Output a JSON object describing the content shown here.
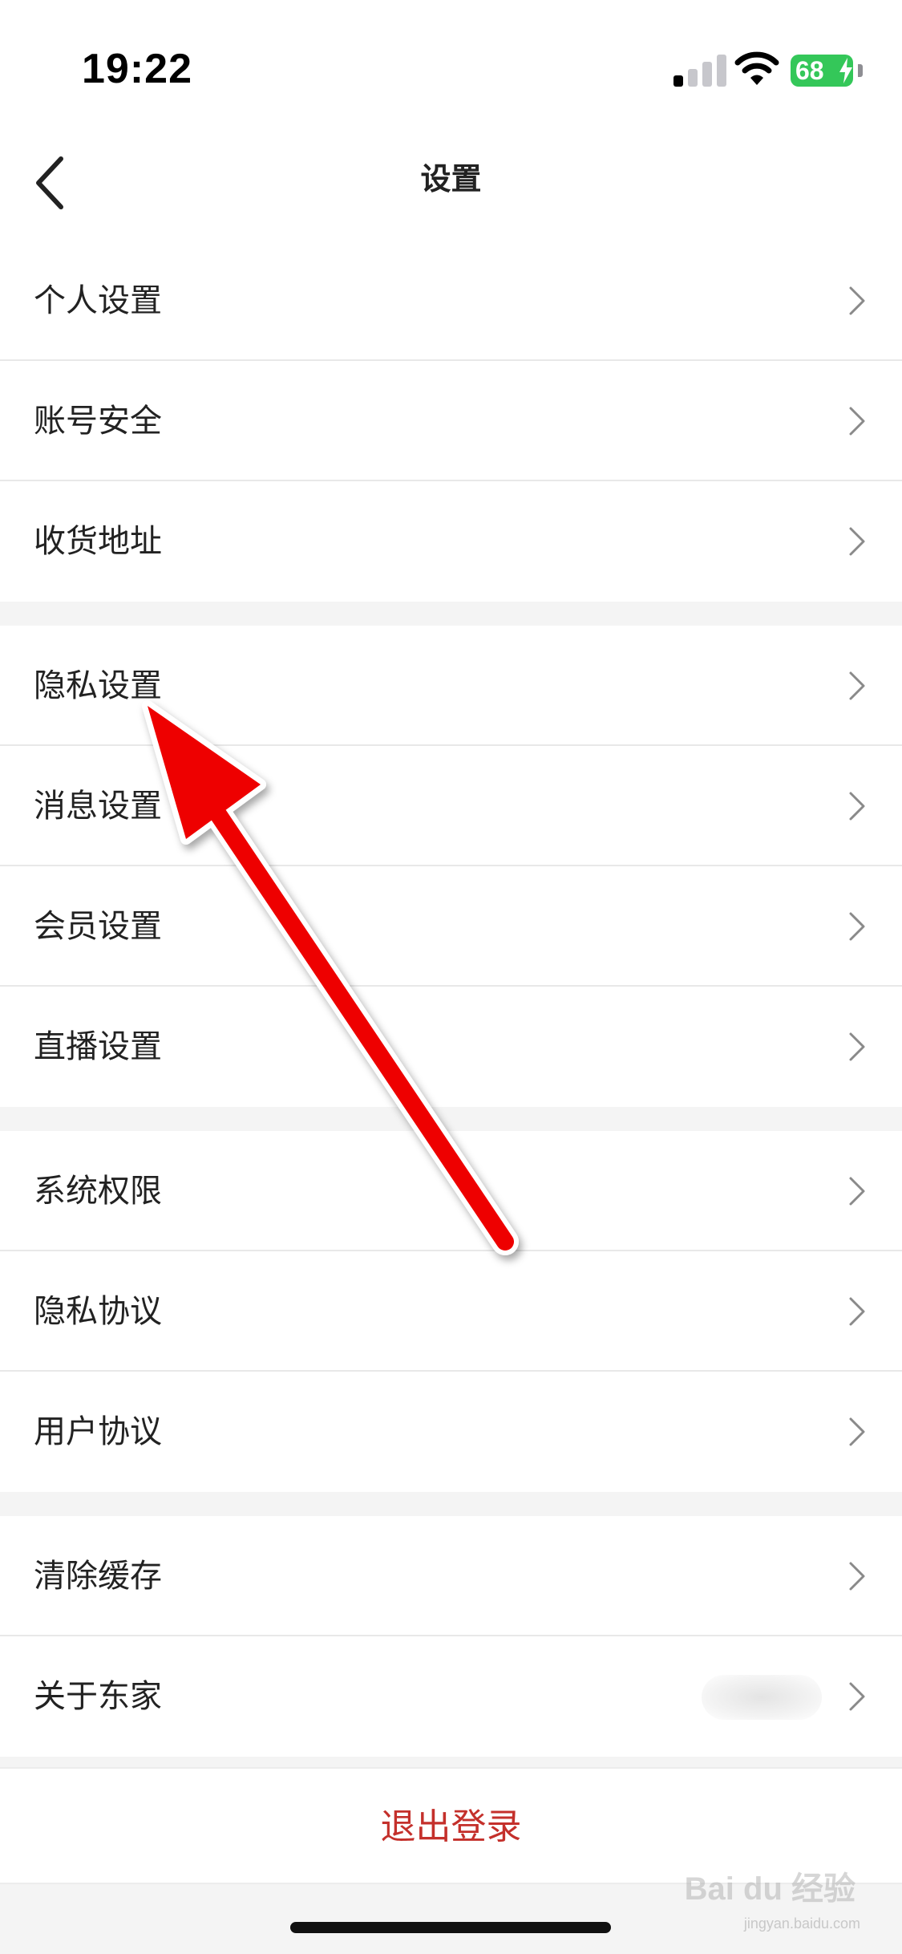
{
  "status_bar": {
    "time": "19:22",
    "battery": "68",
    "signal_bars_on": 1,
    "signal_bars_total": 4
  },
  "nav": {
    "title": "设置",
    "back_icon": "chevron-left-icon"
  },
  "groups": [
    {
      "items": [
        {
          "label": "个人设置"
        },
        {
          "label": "账号安全"
        },
        {
          "label": "收货地址"
        }
      ]
    },
    {
      "items": [
        {
          "label": "隐私设置"
        },
        {
          "label": "消息设置"
        },
        {
          "label": "会员设置"
        },
        {
          "label": "直播设置"
        }
      ]
    },
    {
      "items": [
        {
          "label": "系统权限"
        },
        {
          "label": "隐私协议"
        },
        {
          "label": "用户协议"
        }
      ]
    },
    {
      "items": [
        {
          "label": "清除缓存"
        },
        {
          "label": "关于东家"
        }
      ]
    }
  ],
  "logout": {
    "label": "退出登录"
  },
  "watermark": {
    "text": "Bai du 经验",
    "sub": "jingyan.baidu.com"
  },
  "colors": {
    "logout_red": "#c4302b",
    "annotation_arrow": "#ee0000",
    "battery_green": "#34c759",
    "divider": "#e8e8e8",
    "group_gap": "#f4f4f4"
  }
}
